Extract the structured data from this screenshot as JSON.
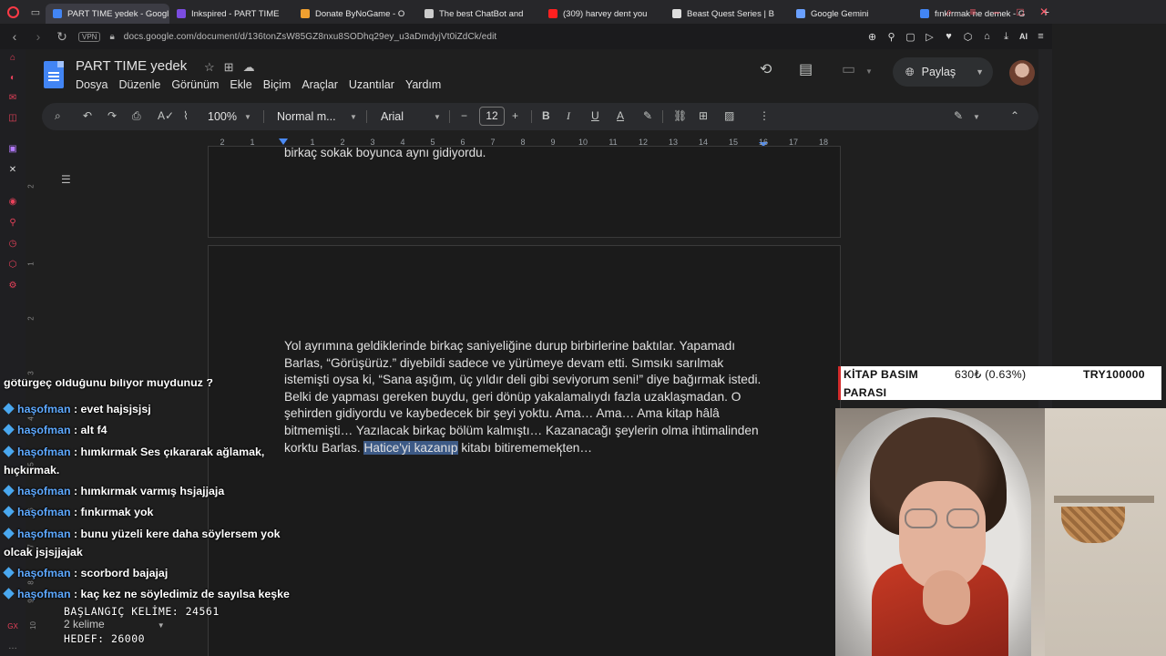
{
  "browser": {
    "tabs": [
      {
        "label": "PART TIME yedek - Googl",
        "color": "#4285f4",
        "active": true
      },
      {
        "label": "Inkspired - PART TIME",
        "color": "#7b4ce0"
      },
      {
        "label": "Donate ByNoGame - O",
        "color": "#f0a030"
      },
      {
        "label": "The best ChatBot and",
        "color": "#cccccc"
      },
      {
        "label": "(309) harvey dent you",
        "color": "#ff2020"
      },
      {
        "label": "Beast Quest Series | B",
        "color": "#dddddd"
      },
      {
        "label": "Google Gemini",
        "color": "#6aa0ff"
      },
      {
        "label": "fınkırmak ne demek - G",
        "color": "#4285f4"
      }
    ],
    "url": "docs.google.com/document/d/136tonZsW85GZ8nxu8SODhq29ey_u3aDmdyjVt0iZdCk/edit",
    "vpn_label": "VPN",
    "ai_label": "AI"
  },
  "docs": {
    "title": "PART TIME  yedek",
    "menus": [
      "Dosya",
      "Düzenle",
      "Görünüm",
      "Ekle",
      "Biçim",
      "Araçlar",
      "Uzantılar",
      "Yardım"
    ],
    "share_label": "Paylaş",
    "zoom": "100%",
    "style": "Normal m...",
    "font": "Arial",
    "font_size": "12",
    "ruler_numbers": [
      "2",
      "1",
      "1",
      "2",
      "3",
      "4",
      "5",
      "6",
      "7",
      "8",
      "9",
      "10",
      "11",
      "12",
      "13",
      "14",
      "15",
      "16",
      "17",
      "18"
    ],
    "vertical_ruler": [
      "2",
      "1",
      "2",
      "3",
      "4",
      "5",
      "6",
      "7",
      "8",
      "9",
      "10"
    ],
    "prev_page_line": "birkaç sokak boyunca aynı gidiyordu.",
    "paragraph_before": "Yol ayrımına geldiklerinde birkaç saniyeliğine durup birbirlerine baktılar. Yapamadı Barlas, “Görüşürüz.” diyebildi sadece ve yürümeye devam etti. Sımsıkı sarılmak istemişti oysa ki, “Sana aşığım, üç yıldır deli gibi seviyorum seni!” diye bağırmak istedi. Belki de yapması gereken buydu, geri dönüp yakalamalıydı fazla uzaklaşmadan. O şehirden gidiyordu ve kaybedecek bir şeyi yoktu. Ama… Ama… Ama kitap hâlâ bitmemişti… Yazılacak birkaç bölüm kalmıştı… Kazanacağı şeylerin olma ihtimalinden korktu Barlas. ",
    "paragraph_selected": "Hatice'yi kazanıp",
    "paragraph_after": " kitabı bitirememekten…",
    "word_count": "2 kelime"
  },
  "chat": {
    "partial_line": "götürgeç olduğunu biliyor muydunuz ?",
    "messages": [
      {
        "user": "haşofman",
        "text": " : evet hajsjsjsj"
      },
      {
        "user": "haşofman",
        "text": " : alt f4"
      },
      {
        "user": "haşofman",
        "text": " : hımkırmak Ses çıkararak ağlamak, hıçkırmak."
      },
      {
        "user": "haşofman",
        "text": " : hımkırmak varmış hsjajjaja"
      },
      {
        "user": "haşofman",
        "text": " : fınkırmak yok"
      },
      {
        "user": "haşofman",
        "text": " : bunu yüzeli kere daha söylersem yok olcak jsjsjjajak"
      },
      {
        "user": "haşofman",
        "text": " : scorbord bajajaj"
      },
      {
        "user": "haşofman",
        "text": " : kaç kez ne söyledimiz de sayılsa keşke"
      }
    ]
  },
  "overlay": {
    "start_words": "BAŞLANGIÇ KELİME: 24561",
    "target": "HEDEF: 26000",
    "ticker_label_1": "KİTAP BASIM",
    "ticker_label_2": "PARASI",
    "ticker_change": "630₺ (0.63%)",
    "ticker_goal": "TRY100000"
  },
  "colors": {
    "accent": "#4285f4",
    "opera": "#ff3a46",
    "selection": "#3d5a86",
    "chat_user": "#5ea9ff",
    "ticker_accent": "#d22b2b"
  }
}
